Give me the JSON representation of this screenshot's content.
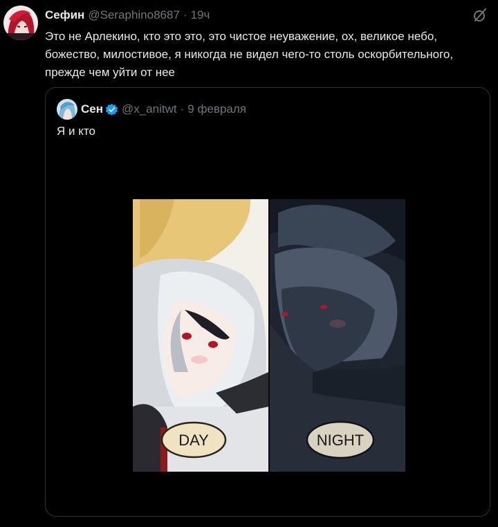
{
  "tweet": {
    "display_name": "Сефин",
    "handle": "@Seraphino8687",
    "separator": "·",
    "time": "19ч",
    "text": "Это не Арлекино, кто это это, это чистое неуважение, ох, великое небо, божество, милостивое, я никогда не видел чего-то столь оскорбительного, прежде чем уйти от нее",
    "avatar_icon": "red-haired-character-avatar",
    "grok_icon": "grok-icon"
  },
  "quoted_tweet": {
    "display_name": "Сен",
    "handle": "@x_anitwt",
    "separator": "·",
    "date": "9 февраля",
    "text": "Я и кто",
    "verified_icon": "verified-badge-icon",
    "avatar_icon": "blue-haired-character-avatar",
    "media": {
      "left_label": "DAY",
      "right_label": "NIGHT"
    }
  },
  "colors": {
    "background": "#000000",
    "text_primary": "#e7e9ea",
    "text_secondary": "#71767b",
    "border": "#2f3336",
    "verified": "#1d9bf0"
  }
}
